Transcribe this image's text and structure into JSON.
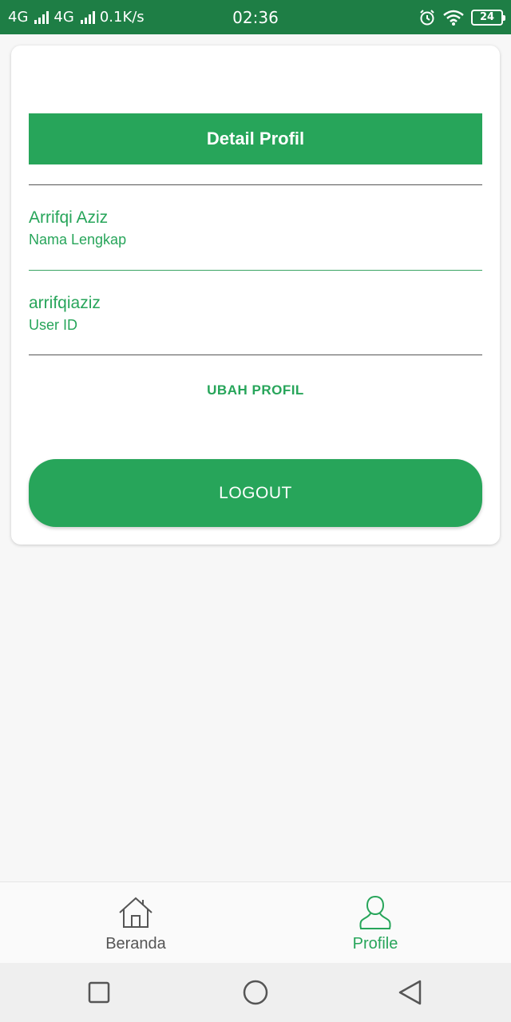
{
  "status_bar": {
    "network1": "4G",
    "network2": "4G",
    "speed": "0.1K/s",
    "time": "02:36",
    "battery": "24"
  },
  "profile": {
    "header_title": "Detail Profil",
    "full_name_value": "Arrifqi Aziz",
    "full_name_label": "Nama Lengkap",
    "user_id_value": "arrifqiaziz",
    "user_id_label": "User ID",
    "edit_label": "UBAH PROFIL",
    "logout_label": "LOGOUT"
  },
  "bottom_nav": {
    "items": [
      {
        "label": "Beranda",
        "icon": "home-icon",
        "active": false
      },
      {
        "label": "Profile",
        "icon": "person-icon",
        "active": true
      }
    ]
  },
  "colors": {
    "accent": "#27a55a",
    "status_bar": "#1e7e45",
    "background": "#f7f7f7"
  },
  "system_nav": {
    "icons": [
      "recent-apps-icon",
      "home-circle-icon",
      "back-icon"
    ]
  }
}
